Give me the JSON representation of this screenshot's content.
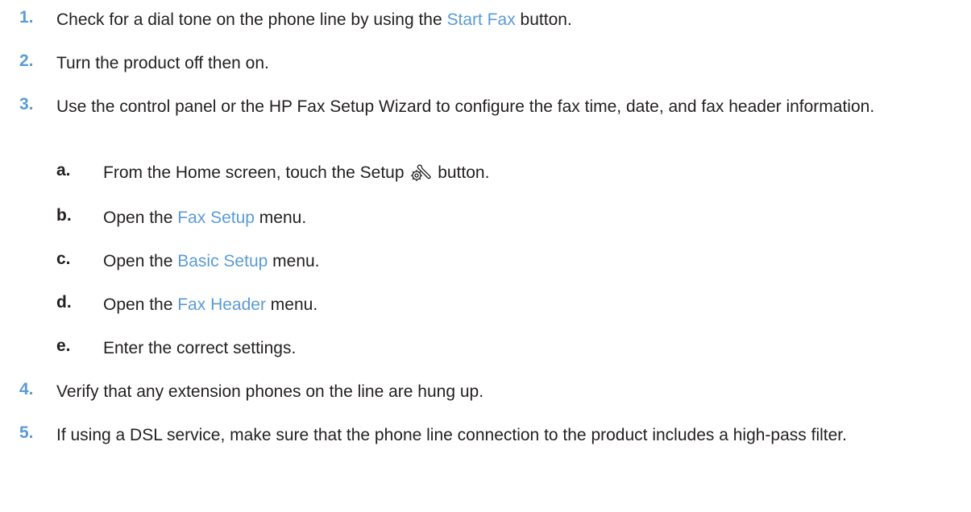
{
  "colors": {
    "accent": "#5b9bd5",
    "text": "#231f20"
  },
  "steps": [
    {
      "num": "1.",
      "pre": "Check for a dial tone on the phone line by using the ",
      "kw": "Start Fax",
      "post": " button."
    },
    {
      "num": "2.",
      "text": "Turn the product off then on."
    },
    {
      "num": "3.",
      "text": "Use the control panel or the HP Fax Setup Wizard to configure the fax time, date, and fax header information.",
      "substeps": [
        {
          "num": "a.",
          "pre": "From the Home screen, touch the Setup ",
          "icon": "setup-wrench-gear-icon",
          "post": " button."
        },
        {
          "num": "b.",
          "pre": "Open the ",
          "kw": "Fax Setup",
          "post": " menu."
        },
        {
          "num": "c.",
          "pre": "Open the ",
          "kw": "Basic Setup",
          "post": " menu."
        },
        {
          "num": "d.",
          "pre": "Open the ",
          "kw": "Fax Header",
          "post": " menu."
        },
        {
          "num": "e.",
          "text": "Enter the correct settings."
        }
      ]
    },
    {
      "num": "4.",
      "text": "Verify that any extension phones on the line are hung up."
    },
    {
      "num": "5.",
      "text": "If using a DSL service, make sure that the phone line connection to the product includes a high-pass filter."
    }
  ]
}
